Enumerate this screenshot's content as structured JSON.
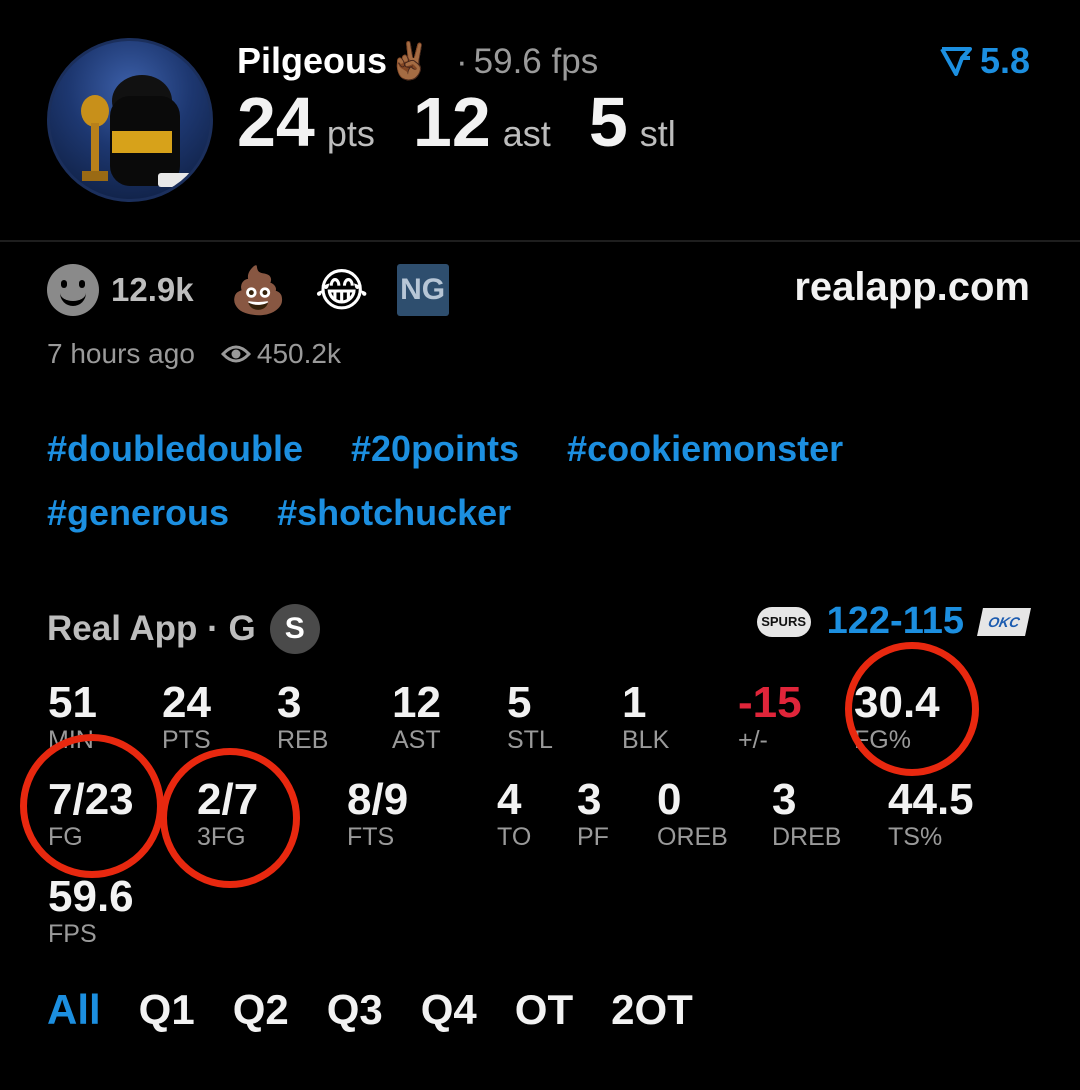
{
  "header": {
    "username": "Pilgeous",
    "username_emoji": "✌🏾",
    "separator": "·",
    "fps_text": "59.6 fps",
    "rating": "5.8",
    "rating_icon": "rating-chevron-icon",
    "headline": [
      {
        "value": "24",
        "unit": "pts"
      },
      {
        "value": "12",
        "unit": "ast"
      },
      {
        "value": "5",
        "unit": "stl"
      }
    ]
  },
  "reactions": {
    "count": "12.9k",
    "emojis": [
      "💩",
      "😂"
    ],
    "ng_label": "NG",
    "site": "realapp.com",
    "time_ago": "7 hours ago",
    "views": "450.2k"
  },
  "tags": [
    "#doubledouble",
    "#20points",
    "#cookiemonster",
    "#generous",
    "#shotchucker"
  ],
  "game": {
    "league_label": "Real App · G",
    "badge": "S",
    "home_logo_text": "SPURS",
    "score_home": "122",
    "score_away": "115",
    "away_logo_text": "OKC"
  },
  "stats": {
    "row1": [
      {
        "value": "51",
        "label": "MIN"
      },
      {
        "value": "24",
        "label": "PTS"
      },
      {
        "value": "3",
        "label": "REB"
      },
      {
        "value": "12",
        "label": "AST"
      },
      {
        "value": "5",
        "label": "STL"
      },
      {
        "value": "1",
        "label": "BLK"
      },
      {
        "value": "-15",
        "label": "+/-"
      },
      {
        "value": "30.4",
        "label": "FG%"
      }
    ],
    "row2": [
      {
        "value": "7/23",
        "label": "FG"
      },
      {
        "value": "2/7",
        "label": "3FG"
      },
      {
        "value": "8/9",
        "label": "FTS"
      },
      {
        "value": "4",
        "label": "TO"
      },
      {
        "value": "3",
        "label": "PF"
      },
      {
        "value": "0",
        "label": "OREB"
      },
      {
        "value": "3",
        "label": "DREB"
      },
      {
        "value": "44.5",
        "label": "TS%"
      }
    ],
    "row3": [
      {
        "value": "59.6",
        "label": "FPS"
      }
    ]
  },
  "tabs": [
    "All",
    "Q1",
    "Q2",
    "Q3",
    "Q4",
    "OT",
    "2OT"
  ],
  "active_tab": "All",
  "colors": {
    "accent": "#1c8fe0",
    "negative": "#e0253a",
    "annotation": "#e8280f"
  }
}
